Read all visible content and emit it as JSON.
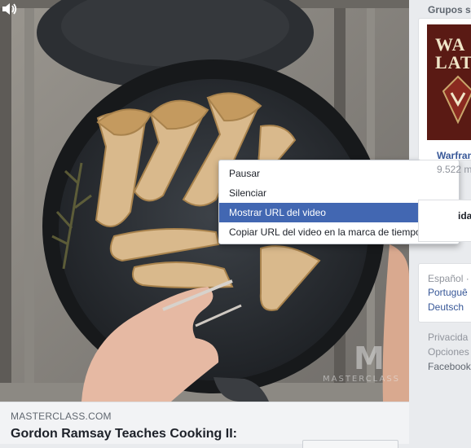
{
  "post": {
    "source": "MASTERCLASS.COM",
    "title": "Gordon Ramsay Teaches Cooking II:",
    "watermark_text": "MASTERCLASS",
    "watermark_letter": "M"
  },
  "context_menu": {
    "items": [
      {
        "label": "Pausar",
        "active": false
      },
      {
        "label": "Silenciar",
        "active": false
      },
      {
        "label": "Mostrar URL del video",
        "active": true
      },
      {
        "label": "Copiar URL del video en la marca de tiempo actual",
        "active": false
      }
    ]
  },
  "sidebar": {
    "groups_heading": "Grupos s",
    "group": {
      "thumb_line1": "WA",
      "thumb_line2": "LAT",
      "name": "Warfram",
      "members": "9.522 m"
    },
    "fragment": "ida",
    "languages": {
      "current": "Español ·",
      "options": [
        "Portuguê",
        "Deutsch"
      ]
    },
    "footer": [
      "Privacida",
      "Opciones",
      "Facebook"
    ]
  },
  "colors": {
    "menu_active": "#4267b2",
    "link": "#385898",
    "page_bg": "#e9ebee"
  }
}
